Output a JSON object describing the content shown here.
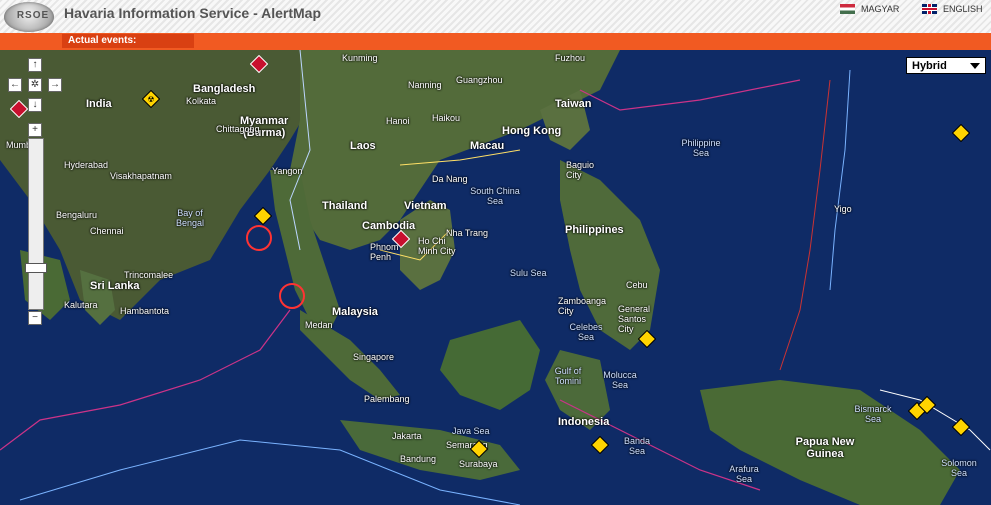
{
  "header": {
    "title": "Havaria Information Service - AlertMap",
    "logo_text": "RSOE",
    "lang_hu": "MAGYAR",
    "lang_en": "ENGLISH"
  },
  "events_tab": "Actual events:",
  "map": {
    "type_selected": "Hybrid",
    "labels": [
      {
        "text": "India",
        "big": true
      },
      {
        "text": "Bangladesh",
        "big": true
      },
      {
        "text": "Myanmar\n(Burma)",
        "big": true
      },
      {
        "text": "Laos",
        "big": true
      },
      {
        "text": "Thailand",
        "big": true
      },
      {
        "text": "Cambodia",
        "big": true
      },
      {
        "text": "Vietnam",
        "big": true
      },
      {
        "text": "Malaysia",
        "big": true
      },
      {
        "text": "Philippines",
        "big": true
      },
      {
        "text": "Indonesia",
        "big": true
      },
      {
        "text": "Papua New Guinea",
        "big": true
      },
      {
        "text": "Sri Lanka",
        "big": true
      },
      {
        "text": "Taiwan",
        "big": true
      },
      {
        "text": "Hong Kong",
        "big": true
      },
      {
        "text": "Macau",
        "big": true
      },
      {
        "text": "Singapore",
        "big": false
      },
      {
        "text": "Bay of Bengal",
        "sea": true
      },
      {
        "text": "South China Sea",
        "sea": true
      },
      {
        "text": "Philippine Sea",
        "sea": true
      },
      {
        "text": "Sulu Sea",
        "sea": true
      },
      {
        "text": "Celebes Sea",
        "sea": true
      },
      {
        "text": "Molucca Sea",
        "sea": true
      },
      {
        "text": "Banda Sea",
        "sea": true
      },
      {
        "text": "Java Sea",
        "sea": true
      },
      {
        "text": "Arafura Sea",
        "sea": true
      },
      {
        "text": "Bismarck Sea",
        "sea": true
      },
      {
        "text": "Solomon Sea",
        "sea": true
      },
      {
        "text": "Gulf of Tomini",
        "sea": true
      },
      {
        "text": "Kunming",
        "big": false
      },
      {
        "text": "Nanning",
        "big": false
      },
      {
        "text": "Guangzhou",
        "big": false
      },
      {
        "text": "Fuzhou",
        "big": false
      },
      {
        "text": "Haikou",
        "big": false
      },
      {
        "text": "Hanoi",
        "big": false
      },
      {
        "text": "Yangon",
        "big": false
      },
      {
        "text": "Chennai",
        "big": false
      },
      {
        "text": "Hyderabad",
        "big": false
      },
      {
        "text": "Kolkata",
        "big": false
      },
      {
        "text": "Chittagong",
        "big": false
      },
      {
        "text": "Visakhapatnam",
        "big": false
      },
      {
        "text": "Bengaluru",
        "big": false
      },
      {
        "text": "Trincomalee",
        "big": false
      },
      {
        "text": "Kalutara",
        "big": false
      },
      {
        "text": "Hambantota",
        "big": false
      },
      {
        "text": "Medan",
        "big": false
      },
      {
        "text": "Palembang",
        "big": false
      },
      {
        "text": "Jakarta",
        "big": false
      },
      {
        "text": "Bandung",
        "big": false
      },
      {
        "text": "Semarang",
        "big": false
      },
      {
        "text": "Surabaya",
        "big": false
      },
      {
        "text": "Da Nang",
        "big": false
      },
      {
        "text": "Nha Trang",
        "big": false
      },
      {
        "text": "Ho Chi Minh City",
        "big": false
      },
      {
        "text": "Phnom Penh",
        "big": false
      },
      {
        "text": "Baguio City",
        "big": false
      },
      {
        "text": "Cebu",
        "big": false
      },
      {
        "text": "Zamboanga City",
        "big": false
      },
      {
        "text": "General Santos City",
        "big": false
      },
      {
        "text": "Yigo",
        "big": false
      },
      {
        "text": "Mumbai",
        "big": false
      }
    ]
  },
  "controls": {
    "up": "↑",
    "down": "↓",
    "left": "←",
    "right": "→",
    "center": "✲",
    "zoom_in": "+",
    "zoom_out": "−"
  },
  "colors": {
    "orange": "#f15a22",
    "ocean": "#0f2b66",
    "land": "#3a5a3a",
    "alert_yellow": "#ffd400",
    "alert_red": "#c8102e"
  },
  "icons": [
    "logo-icon",
    "flag-hu-icon",
    "flag-uk-icon",
    "alert-warning-icon",
    "alert-red-icon"
  ]
}
